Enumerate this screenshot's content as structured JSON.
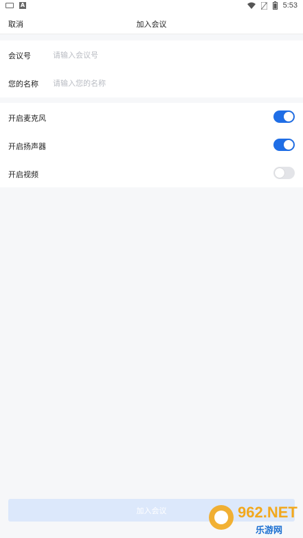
{
  "status_bar": {
    "time": "5:53",
    "icons": [
      "keyboard-icon",
      "a-icon",
      "wifi-icon",
      "sim-icon",
      "battery-icon"
    ]
  },
  "nav": {
    "cancel": "取消",
    "title": "加入会议"
  },
  "form": {
    "meeting_id": {
      "label": "会议号",
      "placeholder": "请输入会议号",
      "value": ""
    },
    "name": {
      "label": "您的名称",
      "placeholder": "请输入您的名称",
      "value": ""
    }
  },
  "toggles": [
    {
      "label": "开启麦克风",
      "on": true
    },
    {
      "label": "开启扬声器",
      "on": true
    },
    {
      "label": "开启视频",
      "on": false
    }
  ],
  "join_button": "加入会议",
  "watermark": {
    "text": "962.NET",
    "sub": "乐游网"
  },
  "colors": {
    "accent": "#1f6ee6",
    "button_disabled": "#dce8fb",
    "background": "#f6f7f9"
  }
}
